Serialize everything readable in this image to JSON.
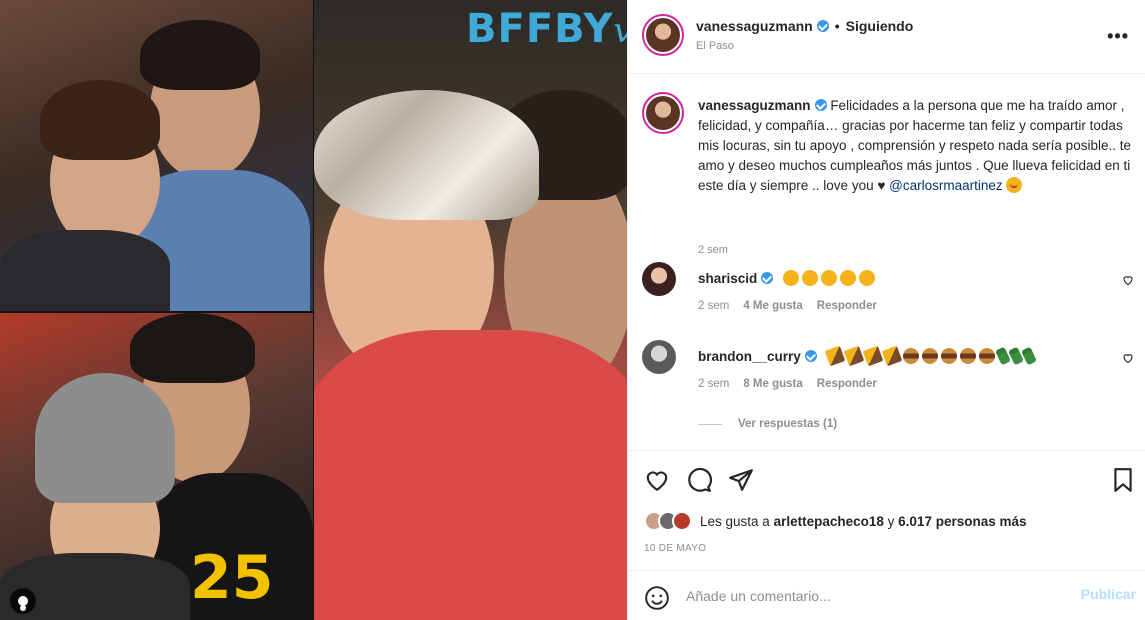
{
  "media": {
    "overlay_text": "BFFBY",
    "overlay_script": "vg"
  },
  "post": {
    "username": "vanessaguzmann",
    "follow_state": "Siguiendo",
    "location": "El Paso",
    "more_icon": "more-horizontal-icon"
  },
  "caption": {
    "username": "vanessaguzmann",
    "text": "Felicidades a la persona que me ha traído amor , felicidad, y compañía… gracias por hacerme tan feliz y compartir todas mis locuras, sin tu apoyo , comprensión y respeto nada sería posible.. te amo y deseo muchos cumpleaños más juntos . Que llueva felicidad en ti este día y siempre .. love you ♥",
    "mention": "@carlosrmaartinez",
    "time": "2 sem"
  },
  "comments": [
    {
      "username": "shariscid",
      "time": "2 sem",
      "likes": "4 Me gusta",
      "reply": "Responder"
    },
    {
      "username": "brandon__curry",
      "time": "2 sem",
      "likes": "8 Me gusta",
      "reply": "Responder"
    }
  ],
  "view_replies": "Ver respuestas (1)",
  "likes": {
    "prefix": "Les gusta a",
    "user": "arlettepacheco18",
    "joiner": "y",
    "others": "6.017 personas más"
  },
  "date": "10 DE MAYO",
  "comment_box": {
    "placeholder": "Añade un comentario...",
    "publish": "Publicar"
  },
  "colors": {
    "verified": "#3897f0",
    "link": "#00376b",
    "publish_disabled": "#b2dffc",
    "overlay_text": "#3fa9d8"
  }
}
